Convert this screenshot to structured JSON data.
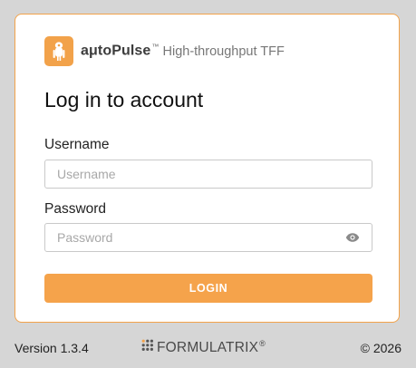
{
  "brand": {
    "name": "aμtoPulse",
    "trademark": "™",
    "subtitle": "High-throughput TFF",
    "logo_icon": "autopulse-logo-icon",
    "accent_color": "#f2a24a"
  },
  "login": {
    "heading": "Log in to account",
    "username_label": "Username",
    "username_placeholder": "Username",
    "username_value": "",
    "password_label": "Password",
    "password_placeholder": "Password",
    "password_value": "",
    "password_toggle_icon": "eye-icon",
    "button_label": "LOGIN"
  },
  "footer": {
    "version": "Version 1.3.4",
    "company": "FORMULATRIX",
    "company_reg": "®",
    "company_icon": "formulatrix-dots-icon",
    "copyright": "© 2026"
  }
}
